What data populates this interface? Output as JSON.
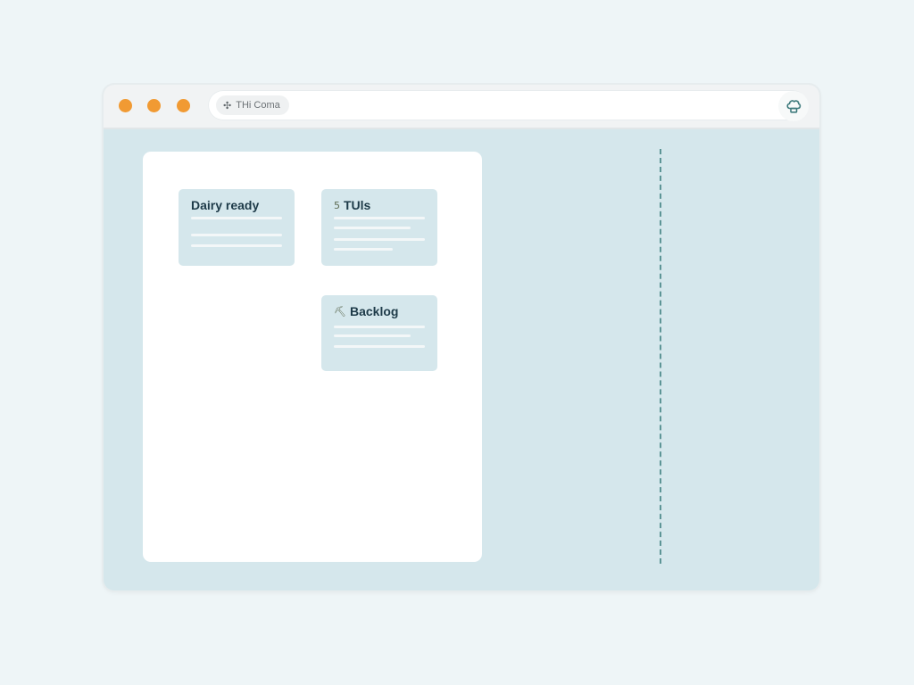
{
  "window": {
    "controls": [
      {
        "name": "close",
        "color": "#f19a33"
      },
      {
        "name": "minimize",
        "color": "#f19a33"
      },
      {
        "name": "maximize",
        "color": "#f19a33"
      }
    ],
    "address_bar": {
      "site_icon": "puzzle-icon",
      "site_label": "THi Coma",
      "url": ""
    },
    "profile_icon": "chef-hat-icon"
  },
  "board": {
    "cards": [
      {
        "title": "Dairy ready",
        "icon": ""
      },
      {
        "title": "TUls",
        "icon": "calendar-icon",
        "icon_glyph": "𝟧"
      },
      {
        "title": "Backlog",
        "icon": "shovel-icon",
        "icon_glyph": "⛏"
      }
    ]
  },
  "colors": {
    "accent": "#f19a33",
    "surface": "#d5e7ec",
    "divider": "#5d9596",
    "card_title": "#1d3a48"
  }
}
